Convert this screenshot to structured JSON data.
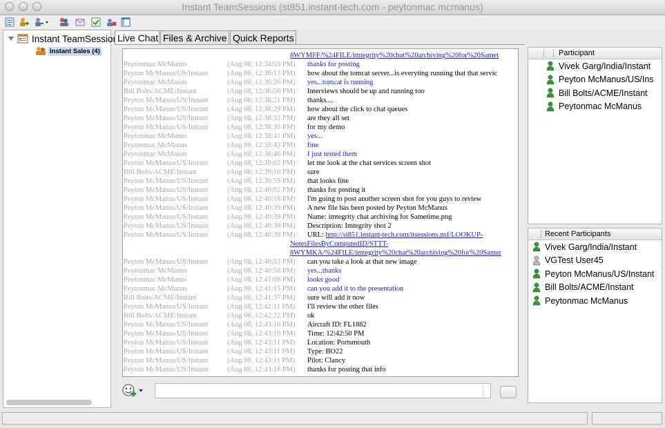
{
  "window": {
    "title": "Instant TeamSessions (st851.instant-tech.com - peytonmac mcmanus)"
  },
  "toolbar": {
    "icons": [
      "list-icon",
      "add-person-icon",
      "add-menu-icon",
      "group-icon",
      "send-icon",
      "check-icon",
      "delete-icon",
      "panel-icon"
    ]
  },
  "tree": {
    "root_label": "Instant TeamSession",
    "child_label": "Instant Sales (4)"
  },
  "tabs": [
    {
      "label": "Live Chat",
      "active": true
    },
    {
      "label": "Files & Archive",
      "active": false
    },
    {
      "label": "Quick Reports",
      "active": false
    }
  ],
  "chat": {
    "top_link": "8WYMFF/%24FILE/imtegrity%20chat%20archiving%20for%20Samet",
    "rows": [
      {
        "who": "Peytonmac McManus",
        "time": "(Aug 08, 12:34:59 PM)",
        "text": "thanks for posting",
        "style": "blue"
      },
      {
        "who": "Peyton McManus/US/Instant",
        "time": "(Aug 08, 12:36:13 PM)",
        "text": "how about the tomcat server...is everyting running that that servic",
        "style": ""
      },
      {
        "who": "Peytonmac McManus",
        "time": "(Aug 08, 12:36:26 PM)",
        "text": "yes...tomcat is running",
        "style": "blue"
      },
      {
        "who": "Bill Bolts/ACME/Instant",
        "time": "(Aug 08, 12:36:56 PM)",
        "text": "Interviews should be up and running too",
        "style": ""
      },
      {
        "who": "Peyton McManus/US/Instant",
        "time": "(Aug 08, 12:38:21 PM)",
        "text": "thanks....",
        "style": ""
      },
      {
        "who": "Peyton McManus/US/Instant",
        "time": "(Aug 08, 12:38:29 PM)",
        "text": "how about the click to chat queues",
        "style": ""
      },
      {
        "who": "Peyton McManus/US/Instant",
        "time": "(Aug 08, 12:38:33 PM)",
        "text": "are they all set",
        "style": ""
      },
      {
        "who": "Peyton McManus/US/Instant",
        "time": "(Aug 08, 12:38:35 PM)",
        "text": "for my demo",
        "style": ""
      },
      {
        "who": "Peytonmac McManus",
        "time": "(Aug 08, 12:38:41 PM)",
        "text": "yes...",
        "style": "blue"
      },
      {
        "who": "Peytonmac McManus",
        "time": "(Aug 08, 12:38:43 PM)",
        "text": "fine",
        "style": "blue"
      },
      {
        "who": "Peytonmac McManus",
        "time": "(Aug 08, 12:38:46 PM)",
        "text": "I just tested them",
        "style": "blue"
      },
      {
        "who": "Peyton McManus/US/Instant",
        "time": "(Aug 08, 12:39:02 PM)",
        "text": "let me look at the chat services screen shot",
        "style": ""
      },
      {
        "who": "Bill Bolts/ACME/Instant",
        "time": "(Aug 08, 12:39:10 PM)",
        "text": "sure",
        "style": ""
      },
      {
        "who": "Peyton McManus/US/Instant",
        "time": "(Aug 08, 12:39:59 PM)",
        "text": "that looks fine",
        "style": ""
      },
      {
        "who": "Peyton McManus/US/Instant",
        "time": "(Aug 08, 12:40:02 PM)",
        "text": "thanks for posting it",
        "style": ""
      },
      {
        "who": "Peyton McManus/US/Instant",
        "time": "(Aug 08, 12:40:18 PM)",
        "text": "I'm going to post another screen shot for you guys to review",
        "style": ""
      },
      {
        "who": "Peyton McManus/US/Instant",
        "time": "(Aug 08, 12:40:39 PM)",
        "text": "A new file has been posted by Peyton McManus",
        "style": ""
      },
      {
        "who": "Peyton McManus/US/Instant",
        "time": "(Aug 08, 12:40:39 PM)",
        "text": "Name: imtegrity chat archiving for Sametime.png",
        "style": ""
      },
      {
        "who": "Peyton McManus/US/Instant",
        "time": "(Aug 08, 12:40:39 PM)",
        "text": "Description: Imtegrity shot 2",
        "style": ""
      },
      {
        "who": "Peyton McManus/US/Instant",
        "time": "(Aug 08, 12:40:39 PM)",
        "text": "URL: ",
        "style": "url",
        "link": "http://st851.instant-tech.com/itsessions.nsf/LOOKUP-"
      },
      {
        "who": "Peyton McManus/US/Instant",
        "time": "(Aug 08, 12:40:53 PM)",
        "text": "can you take a look at that new image",
        "style": ""
      },
      {
        "who": "Peytonmac McManus",
        "time": "(Aug 08, 12:40:58 PM)",
        "text": "yes...thanks",
        "style": "blue"
      },
      {
        "who": "Peytonmac McManus",
        "time": "(Aug 08, 12:41:08 PM)",
        "text": "looks good",
        "style": "blue"
      },
      {
        "who": "Peytonmac McManus",
        "time": "(Aug 08, 12:41:15 PM)",
        "text": "can you add it to the presentation",
        "style": "blue"
      },
      {
        "who": "Bill Bolts/ACME/Instant",
        "time": "(Aug 08, 12:41:37 PM)",
        "text": "sure will add it now",
        "style": ""
      },
      {
        "who": "Peyton McManus/US/Instant",
        "time": "(Aug 08, 12:42:11 PM)",
        "text": "I'll review the other files",
        "style": ""
      },
      {
        "who": "Bill Bolts/ACME/Instant",
        "time": "(Aug 08, 12:42:22 PM)",
        "text": "ok",
        "style": ""
      },
      {
        "who": "Peyton McManus/US/Instant",
        "time": "(Aug 08, 12:43:10 PM)",
        "text": "Aircraft ID: FL1882",
        "style": ""
      },
      {
        "who": "Peyton McManus/US/Instant",
        "time": "(Aug 08, 12:43:10 PM)",
        "text": "Time: 12:42:50 PM",
        "style": ""
      },
      {
        "who": "Peyton McManus/US/Instant",
        "time": "(Aug 08, 12:43:11 PM)",
        "text": "Location: Portsmouth",
        "style": ""
      },
      {
        "who": "Peyton McManus/US/Instant",
        "time": "(Aug 08, 12:43:11 PM)",
        "text": "Type: BO22",
        "style": ""
      },
      {
        "who": "Peyton McManus/US/Instant",
        "time": "(Aug 08, 12:43:11 PM)",
        "text": "Pilot: Clancy",
        "style": ""
      },
      {
        "who": "Peyton McManus/US/Instant",
        "time": "(Aug 08, 12:43:18 PM)",
        "text": "thanks for posting that info",
        "style": ""
      }
    ],
    "url_continuation": [
      "NotesFilesByComputedID/STTT-",
      "8WYMKA/%24FILE/imtegrity%20chat%20archiving%20for%20Samet"
    ],
    "input_value": ""
  },
  "participants": {
    "header": "Participant",
    "items": [
      {
        "name": "Vivek Garg/India/Instant",
        "status": "online"
      },
      {
        "name": "Peyton McManus/US/Ins",
        "status": "online"
      },
      {
        "name": "Bill Bolts/ACME/Instant",
        "status": "online"
      },
      {
        "name": "Peytonmac McManus",
        "status": "online"
      }
    ]
  },
  "recent": {
    "header": "Recent Participants",
    "items": [
      {
        "name": "Vivek Garg/India/Instant",
        "status": "online"
      },
      {
        "name": "VGTest User45",
        "status": "offline"
      },
      {
        "name": "Peyton McManus/US/Instant",
        "status": "online"
      },
      {
        "name": "Bill Bolts/ACME/Instant",
        "status": "online"
      },
      {
        "name": "Peytonmac McManus",
        "status": "online"
      }
    ]
  },
  "colors": {
    "online": "#2e9b2e",
    "offline": "#b8b8b8",
    "link": "#1d1fd4",
    "muted": "#a8a8a8"
  }
}
